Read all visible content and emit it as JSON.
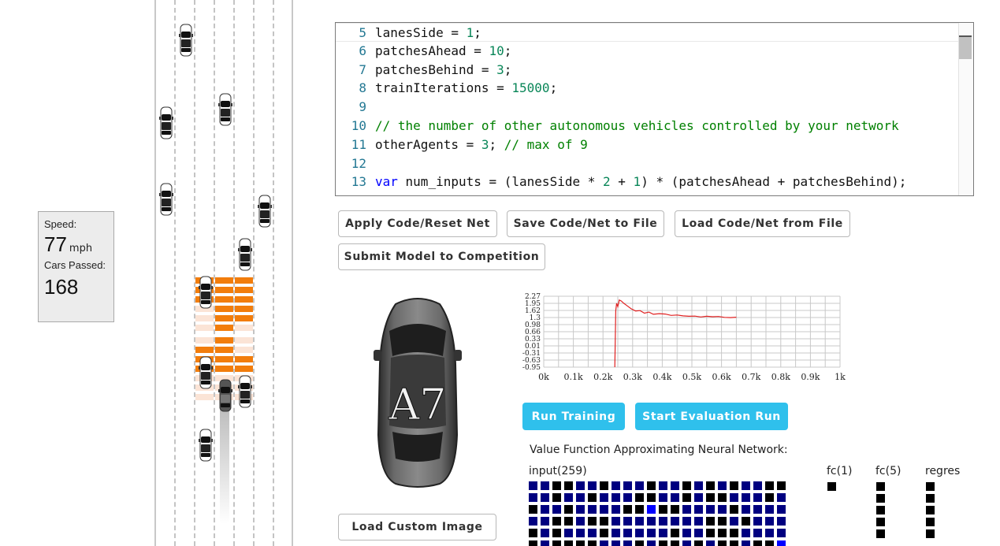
{
  "stats": {
    "speed_label": "Speed:",
    "speed_value": "77",
    "speed_unit": "mph",
    "passed_label": "Cars Passed:",
    "passed_value": "168"
  },
  "editor": {
    "lines": [
      {
        "n": "5",
        "parts": [
          [
            "t",
            "lanesSide = "
          ],
          [
            "num",
            "1"
          ],
          [
            "t",
            ";"
          ]
        ]
      },
      {
        "n": "6",
        "parts": [
          [
            "t",
            "patchesAhead = "
          ],
          [
            "num",
            "10"
          ],
          [
            "t",
            ";"
          ]
        ]
      },
      {
        "n": "7",
        "parts": [
          [
            "t",
            "patchesBehind = "
          ],
          [
            "num",
            "3"
          ],
          [
            "t",
            ";"
          ]
        ]
      },
      {
        "n": "8",
        "parts": [
          [
            "t",
            "trainIterations = "
          ],
          [
            "num",
            "15000"
          ],
          [
            "t",
            ";"
          ]
        ]
      },
      {
        "n": "9",
        "parts": []
      },
      {
        "n": "10",
        "parts": [
          [
            "cmt",
            "// the number of other autonomous vehicles controlled by your network"
          ]
        ]
      },
      {
        "n": "11",
        "parts": [
          [
            "t",
            "otherAgents = "
          ],
          [
            "num",
            "3"
          ],
          [
            "t",
            "; "
          ],
          [
            "cmt",
            "// max of 9"
          ]
        ]
      },
      {
        "n": "12",
        "parts": []
      },
      {
        "n": "13",
        "parts": [
          [
            "kw",
            "var"
          ],
          [
            "t",
            " num_inputs = (lanesSide * "
          ],
          [
            "num",
            "2"
          ],
          [
            "t",
            " + "
          ],
          [
            "num",
            "1"
          ],
          [
            "t",
            ") * (patchesAhead + patchesBehind);"
          ]
        ]
      }
    ]
  },
  "buttons": {
    "apply": "Apply Code/Reset Net",
    "save": "Save Code/Net to File",
    "load": "Load Code/Net from File",
    "submit": "Submit Model to Competition",
    "run_training": "Run Training",
    "start_eval": "Start Evaluation Run",
    "load_image": "Load Custom Image"
  },
  "car_image": {
    "badge": "A7"
  },
  "chart_data": {
    "type": "line",
    "title": "",
    "xlabel": "",
    "ylabel": "",
    "x_ticks": [
      "0k",
      "0.1k",
      "0.2k",
      "0.3k",
      "0.4k",
      "0.5k",
      "0.6k",
      "0.7k",
      "0.8k",
      "0.9k",
      "1k"
    ],
    "y_ticks": [
      "2.27",
      "1.95",
      "1.62",
      "1.3",
      "0.98",
      "0.66",
      "0.33",
      "0.01",
      "-0.31",
      "-0.63",
      "-0.95"
    ],
    "xlim": [
      0,
      1000
    ],
    "ylim": [
      -0.95,
      2.27
    ],
    "grid": true,
    "series": [
      {
        "color": "#e02020",
        "x": [
          240,
          243,
          246,
          250,
          255,
          262,
          270,
          280,
          295,
          310,
          325,
          340,
          355,
          370,
          390,
          410,
          430,
          450,
          470,
          490,
          510,
          530,
          550,
          570,
          590,
          610,
          630,
          650
        ],
        "y": [
          -0.95,
          1.62,
          1.95,
          1.8,
          2.1,
          2.05,
          1.95,
          1.85,
          1.7,
          1.6,
          1.62,
          1.5,
          1.55,
          1.45,
          1.48,
          1.46,
          1.4,
          1.42,
          1.38,
          1.36,
          1.37,
          1.33,
          1.36,
          1.34,
          1.35,
          1.31,
          1.3,
          1.32
        ]
      }
    ]
  },
  "nn": {
    "title": "Value Function Approximating Neural Network:",
    "layers": [
      "input(259)",
      "fc(1)",
      "fc(5)",
      "regres"
    ]
  },
  "colors": {
    "orange_patch": "#f27d0c",
    "light_patch": "#fbe4d6",
    "button_blue": "#2fc0ec",
    "nn_dark_blue": "#000080",
    "nn_bright_blue": "#0000ff"
  }
}
